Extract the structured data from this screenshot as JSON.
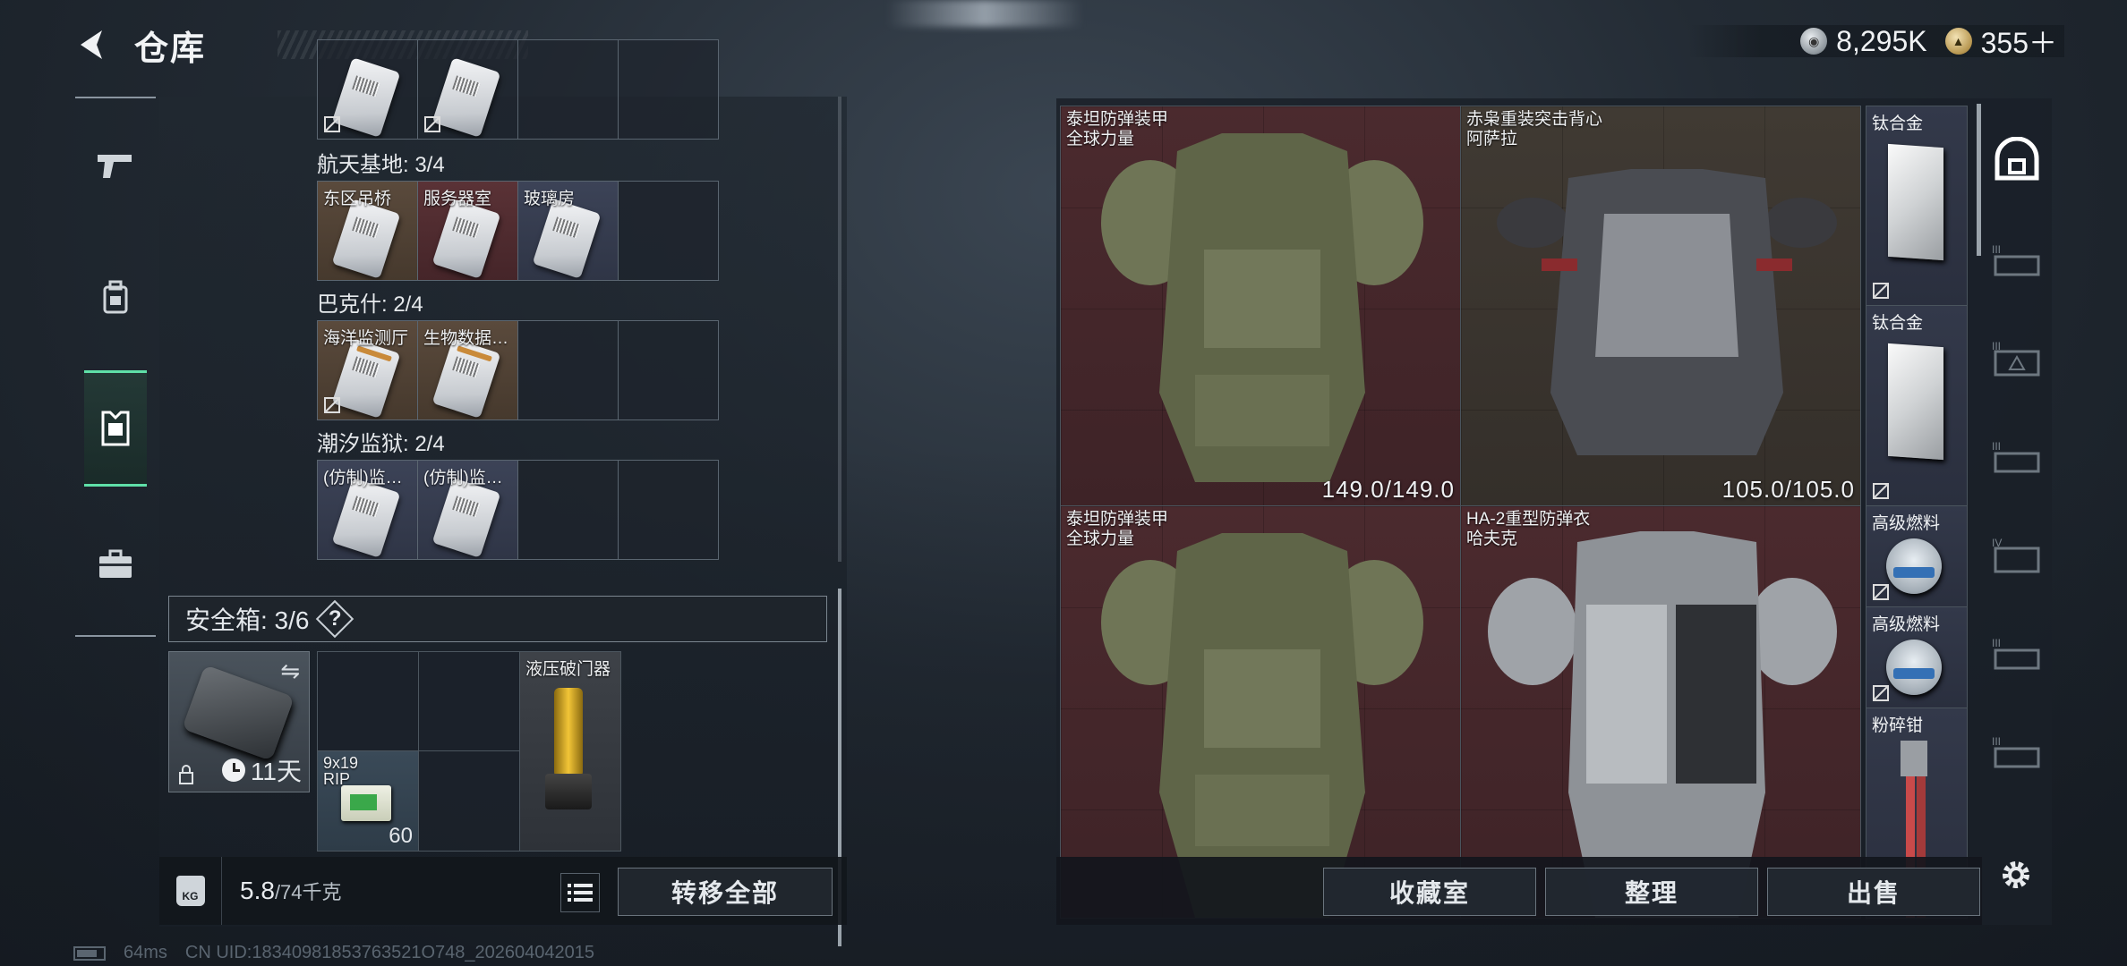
{
  "header": {
    "title": "仓库",
    "currency_silver": "8,295K",
    "currency_gold": "355＋"
  },
  "left_rail": {
    "items": [
      "gun-icon",
      "backpack-icon",
      "vest-icon",
      "case-icon"
    ],
    "active_index": 2
  },
  "keycards": {
    "groups": [
      {
        "title": "航天基地: 3/4",
        "cards": [
          {
            "label": "东区吊桥",
            "color": "brown"
          },
          {
            "label": "服务器室",
            "color": "red"
          },
          {
            "label": "玻璃房",
            "color": "blue"
          }
        ]
      },
      {
        "title": "巴克什: 2/4",
        "cards": [
          {
            "label": "海洋监测厅",
            "color": "brown"
          },
          {
            "label": "生物数据…",
            "color": "brown"
          }
        ]
      },
      {
        "title": "潮汐监狱: 2/4",
        "cards": [
          {
            "label": "(仿制)监…",
            "color": "blue"
          },
          {
            "label": "(仿制)监…",
            "color": "blue"
          }
        ]
      }
    ]
  },
  "safebox": {
    "header": "安全箱: 3/6",
    "help": "?",
    "timer": "11天",
    "items": [
      {
        "name": "9x19 RIP",
        "count": "60"
      },
      {
        "name": "液压破门器"
      }
    ]
  },
  "footer_left": {
    "weight_current": "5.8",
    "weight_max": "/74千克",
    "transfer_label": "转移全部"
  },
  "status": {
    "ping": "64ms",
    "uid": "CN UID:18340981853763521O748_202604042015"
  },
  "armor": [
    {
      "name": "泰坦防弹装甲",
      "maker": "全球力量",
      "durability": "149.0/149.0",
      "color": "red"
    },
    {
      "name": "赤枭重装突击背心",
      "maker": "阿萨拉",
      "durability": "105.0/105.0",
      "color": "brown"
    },
    {
      "name": "泰坦防弹装甲",
      "maker": "全球力量",
      "durability": "",
      "color": "red"
    },
    {
      "name": "HA-2重型防弹衣",
      "maker": "哈夫克",
      "durability": "",
      "color": "red"
    }
  ],
  "side_items": [
    {
      "name": "钛合金"
    },
    {
      "name": "钛合金"
    },
    {
      "name": "高级燃料"
    },
    {
      "name": "高级燃料"
    },
    {
      "name": "粉碎钳"
    }
  ],
  "footer_right": {
    "collection_label": "收藏室",
    "sort_label": "整理",
    "sell_label": "出售"
  },
  "right_rail": [
    "helmet-icon",
    "armor-slot-1",
    "armor-slot-2",
    "armor-slot-3",
    "armor-slot-4",
    "armor-slot-5",
    "armor-slot-6"
  ],
  "colors": {
    "accent": "#5fe0a8",
    "red_cell": "#4b2a2e",
    "brown_cell": "#403a33",
    "blue_cell": "#3c4357"
  }
}
